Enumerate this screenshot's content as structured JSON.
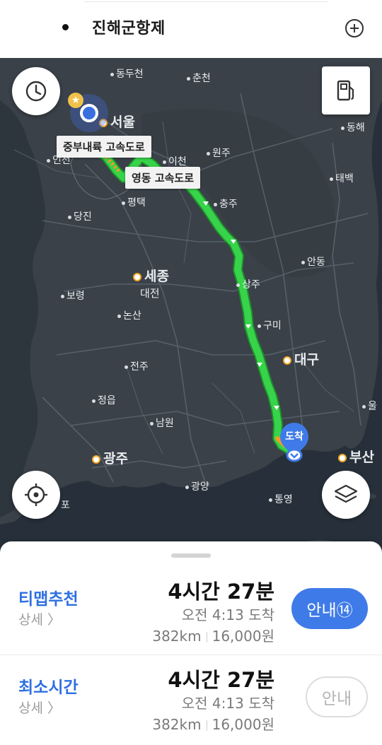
{
  "search": {
    "destination": "진해군항제",
    "add_icon": "plus-circle-icon"
  },
  "map": {
    "cities": {
      "dongducheon": "동두천",
      "chuncheon": "춘천",
      "seoul": "서울",
      "incheon": "인천",
      "icheon": "이천",
      "wonju": "원주",
      "donghae": "동해",
      "taebaek": "태백",
      "pyeongtaek": "평택",
      "chungju": "충주",
      "dangjin": "당진",
      "andong": "안동",
      "sejong": "세종",
      "daejeon": "대전",
      "sangju": "상주",
      "boryeong": "보령",
      "nonsan": "논산",
      "gumi": "구미",
      "daegu": "대구",
      "jeonju": "전주",
      "jeongeup": "정읍",
      "ulsan": "울",
      "namwon": "남원",
      "busan": "부산",
      "gwangju": "광주",
      "gwangyang": "광양",
      "tongyeong": "통영",
      "mokpo": "포"
    },
    "road_labels": {
      "jungbu": "중부내륙 고속도로",
      "yeongdong": "영동 고속도로"
    },
    "destination_pin": "도착",
    "buttons": {
      "history_icon": "clock-icon",
      "fuel_icon": "gas-station-icon",
      "locate_icon": "crosshair-icon",
      "layers_icon": "layers-icon"
    },
    "route_color": "#37d34a"
  },
  "routes": [
    {
      "name": "티맵추천",
      "detail": "상세 〉",
      "duration": "4시간 27분",
      "arrival": "오전 4:13 도착",
      "distance": "382km",
      "fare": "16,000원",
      "button_label": "안내⑭"
    },
    {
      "name": "최소시간",
      "detail": "상세 〉",
      "duration": "4시간 27분",
      "arrival": "오전 4:13 도착",
      "distance": "382km",
      "fare": "16,000원",
      "button_label": "안내"
    }
  ],
  "colors": {
    "accent": "#3f7be8",
    "route_green": "#37d34a",
    "map_bg": "#2a3036"
  }
}
